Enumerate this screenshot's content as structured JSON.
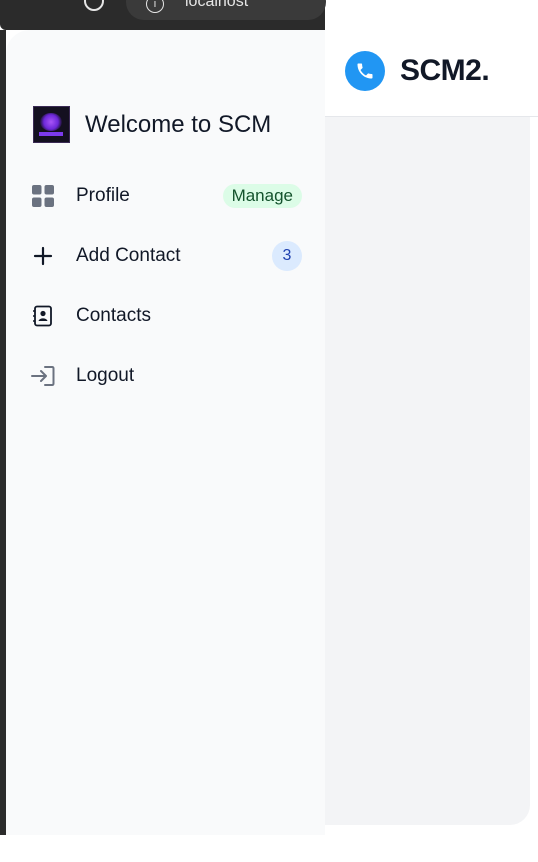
{
  "browser": {
    "address_text": "localhost"
  },
  "brand": {
    "name": "SCM2.",
    "icon": "phone-icon",
    "color": "#2196f3"
  },
  "sidebar": {
    "welcome": "Welcome to SCM",
    "items": [
      {
        "label": "Profile",
        "icon": "grid-icon",
        "badge": "Manage"
      },
      {
        "label": "Add Contact",
        "icon": "plus-icon",
        "badge": "3"
      },
      {
        "label": "Contacts",
        "icon": "contact-card-icon"
      },
      {
        "label": "Logout",
        "icon": "logout-icon"
      }
    ]
  }
}
